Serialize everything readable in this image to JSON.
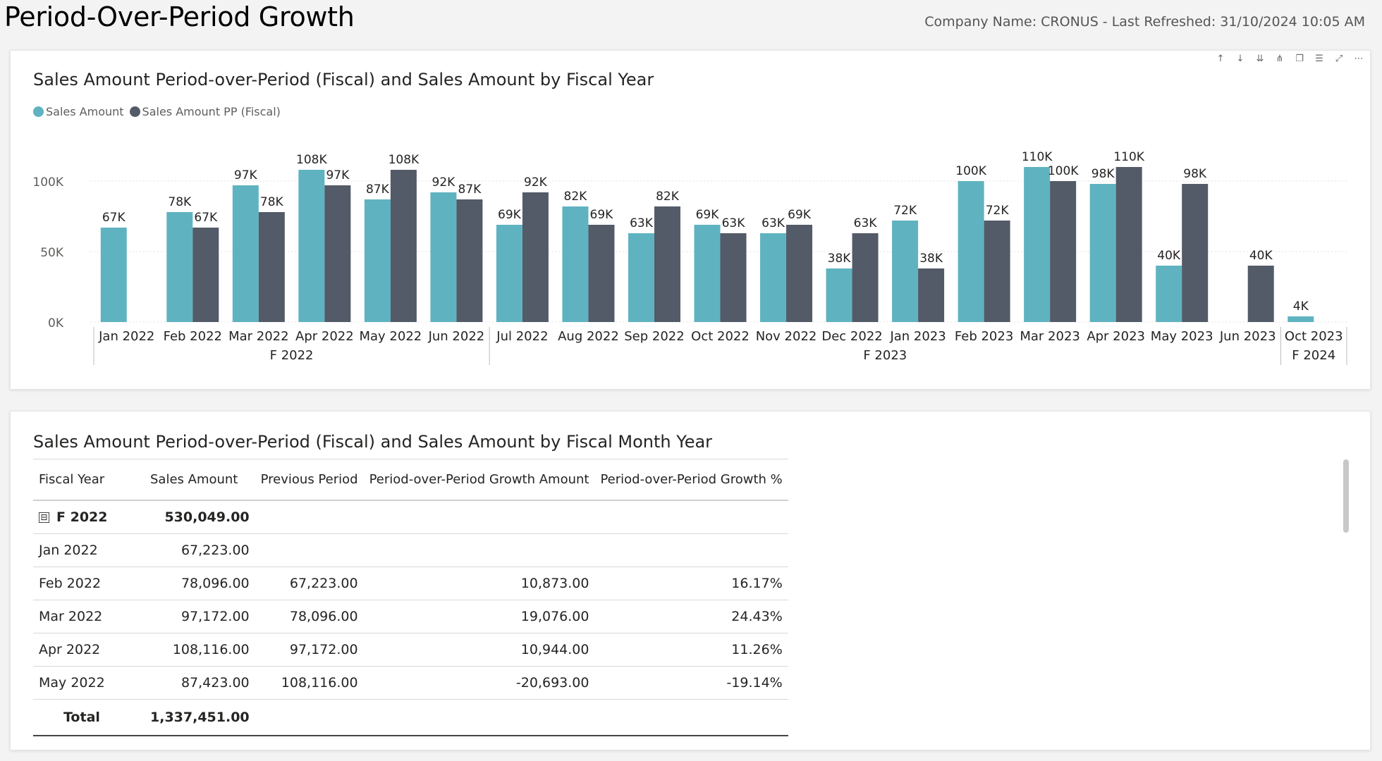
{
  "header": {
    "title": "Period-Over-Period Growth",
    "subtitle": "Company Name: CRONUS - Last Refreshed: 31/10/2024 10:05 AM"
  },
  "chart_card": {
    "title": "Sales Amount Period-over-Period (Fiscal) and Sales Amount by Fiscal Year",
    "toolbar": [
      "arrow-up-icon",
      "arrow-down-icon",
      "double-arrow-down-icon",
      "expand-hierarchy-icon",
      "copy-icon",
      "filter-icon",
      "focus-mode-icon",
      "more-options-icon"
    ]
  },
  "colors": {
    "sales": "#5fb3c0",
    "pp": "#535a68",
    "grid": "#e1e1e1",
    "axis_text": "#605e5c",
    "label_text": "#252423"
  },
  "chart_data": {
    "type": "bar",
    "title": "Sales Amount Period-over-Period (Fiscal) and Sales Amount by Fiscal Year",
    "legend_position": "top-left",
    "grid": true,
    "ylim": [
      0,
      110000
    ],
    "yticks": [
      {
        "value": 0,
        "label": "0K"
      },
      {
        "value": 50000,
        "label": "50K"
      },
      {
        "value": 100000,
        "label": "100K"
      }
    ],
    "categories": [
      "Jan 2022",
      "Feb 2022",
      "Mar 2022",
      "Apr 2022",
      "May 2022",
      "Jun 2022",
      "Jul 2022",
      "Aug 2022",
      "Sep 2022",
      "Oct 2022",
      "Nov 2022",
      "Dec 2022",
      "Jan 2023",
      "Feb 2023",
      "Mar 2023",
      "Apr 2023",
      "May 2023",
      "Jun 2023",
      "Oct 2023"
    ],
    "fiscal_groups": [
      {
        "label": "F 2022",
        "start": 0,
        "end": 5
      },
      {
        "label": "F 2023",
        "start": 6,
        "end": 17
      },
      {
        "label": "F 2024",
        "start": 18,
        "end": 18
      }
    ],
    "series": [
      {
        "name": "Sales Amount",
        "values": [
          67000,
          78000,
          97000,
          108000,
          87000,
          92000,
          69000,
          82000,
          63000,
          69000,
          63000,
          38000,
          72000,
          100000,
          110000,
          98000,
          40000,
          null,
          4000
        ],
        "labels": [
          "67K",
          "78K",
          "97K",
          "108K",
          "87K",
          "92K",
          "69K",
          "82K",
          "63K",
          "69K",
          "63K",
          "38K",
          "72K",
          "100K",
          "110K",
          "98K",
          "40K",
          "",
          "4K"
        ]
      },
      {
        "name": "Sales Amount PP (Fiscal)",
        "values": [
          null,
          67000,
          78000,
          97000,
          108000,
          87000,
          92000,
          69000,
          82000,
          63000,
          69000,
          63000,
          38000,
          72000,
          100000,
          110000,
          98000,
          40000,
          null
        ],
        "labels": [
          "",
          "67K",
          "78K",
          "97K",
          "108K",
          "87K",
          "92K",
          "69K",
          "82K",
          "63K",
          "69K",
          "63K",
          "38K",
          "72K",
          "100K",
          "110K",
          "98K",
          "40K",
          ""
        ]
      }
    ]
  },
  "table_card": {
    "title": "Sales Amount Period-over-Period (Fiscal) and Sales Amount by Fiscal Month Year",
    "columns": [
      "Fiscal Year",
      "Sales Amount",
      "Previous Period",
      "Period-over-Period Growth Amount",
      "Period-over-Period Growth %"
    ],
    "group": {
      "expander": "⊟",
      "label": "F 2022",
      "sales": "530,049.00"
    },
    "rows": [
      {
        "month": "Jan 2022",
        "sales": "67,223.00",
        "previous": "",
        "growth": "",
        "pct": ""
      },
      {
        "month": "Feb 2022",
        "sales": "78,096.00",
        "previous": "67,223.00",
        "growth": "10,873.00",
        "pct": "16.17%"
      },
      {
        "month": "Mar 2022",
        "sales": "97,172.00",
        "previous": "78,096.00",
        "growth": "19,076.00",
        "pct": "24.43%"
      },
      {
        "month": "Apr 2022",
        "sales": "108,116.00",
        "previous": "97,172.00",
        "growth": "10,944.00",
        "pct": "11.26%"
      },
      {
        "month": "May 2022",
        "sales": "87,423.00",
        "previous": "108,116.00",
        "growth": "-20,693.00",
        "pct": "-19.14%"
      }
    ],
    "total": {
      "label": "Total",
      "sales": "1,337,451.00"
    }
  }
}
